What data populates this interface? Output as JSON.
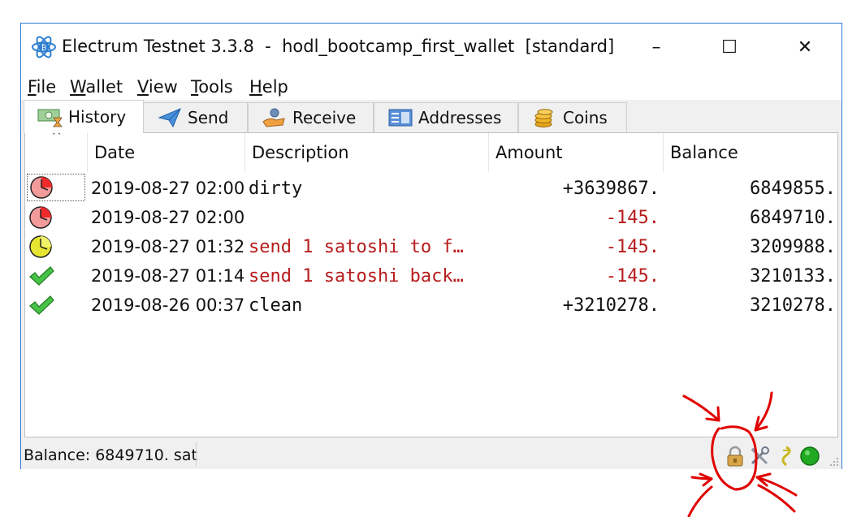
{
  "window": {
    "title": "Electrum Testnet 3.3.8  -  hodl_bootcamp_first_wallet  [standard]",
    "controls": {
      "minimize": "–",
      "maximize": "☐",
      "close": "✕"
    }
  },
  "menu": [
    {
      "accel": "F",
      "rest": "ile"
    },
    {
      "accel": "W",
      "rest": "allet"
    },
    {
      "accel": "V",
      "rest": "iew"
    },
    {
      "accel": "T",
      "rest": "ools"
    },
    {
      "accel": "H",
      "rest": "elp"
    }
  ],
  "tabs": [
    {
      "label": "History",
      "icon": "history-icon",
      "active": true
    },
    {
      "label": "Send",
      "icon": "send-icon",
      "active": false
    },
    {
      "label": "Receive",
      "icon": "receive-icon",
      "active": false
    },
    {
      "label": "Addresses",
      "icon": "addresses-icon",
      "active": false
    },
    {
      "label": "Coins",
      "icon": "coins-icon",
      "active": false
    }
  ],
  "history": {
    "sort_indicator": "^",
    "columns": [
      "Date",
      "Description",
      "Amount",
      "Balance"
    ],
    "rows": [
      {
        "status_icon": "clock-red-icon",
        "date": "2019-08-27 02:00",
        "description": "dirty",
        "amount": "+3639867.",
        "balance": "6849855."
      },
      {
        "status_icon": "clock-red-icon",
        "date": "2019-08-27 02:00",
        "description": "",
        "amount": "-145.",
        "balance": "6849710."
      },
      {
        "status_icon": "clock-yellow-icon",
        "date": "2019-08-27 01:32",
        "description": "send 1 satoshi to f…",
        "amount": "-145.",
        "balance": "3209988."
      },
      {
        "status_icon": "checkmark-icon",
        "date": "2019-08-27 01:14",
        "description": "send 1 satoshi back…",
        "amount": "-145.",
        "balance": "3210133."
      },
      {
        "status_icon": "checkmark-icon",
        "date": "2019-08-26 00:37",
        "description": "clean",
        "amount": "+3210278.",
        "balance": "3210278."
      }
    ]
  },
  "statusbar": {
    "balance_text": "Balance: 6849710. sat",
    "icons": [
      "lock-icon",
      "tools-icon",
      "seed-icon",
      "network-status-icon"
    ]
  },
  "colors": {
    "negative_text": "#b81c1c",
    "normal_text": "#111111",
    "network_ok": "#21a821",
    "annotation": "#e00000"
  }
}
